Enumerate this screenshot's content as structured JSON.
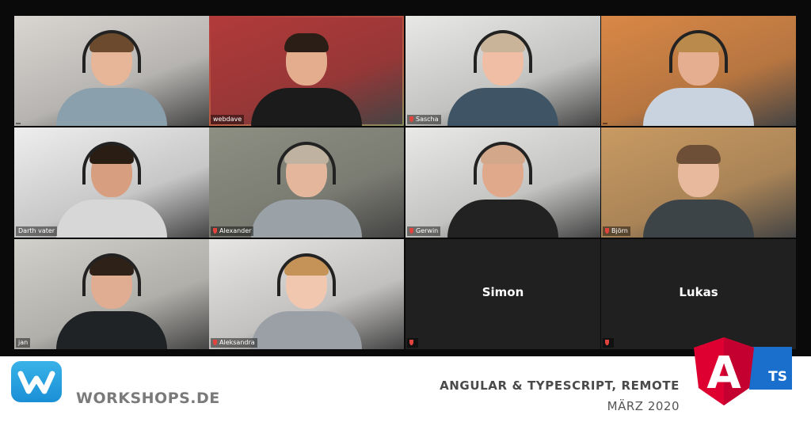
{
  "participants": [
    {
      "name": "",
      "skin": "#e7b597",
      "hair": "#6b4a2e",
      "shirt": "#8aa0ad",
      "bg": "#d9d6d2",
      "headset": true
    },
    {
      "name": "webdave",
      "skin": "#e3ad8e",
      "hair": "#2b1e16",
      "shirt": "#1b1b1b",
      "bg": "#b23a3a",
      "headset": false,
      "active": true
    },
    {
      "name": "Sascha",
      "skin": "#efbea4",
      "hair": "#c9b49a",
      "shirt": "#3f5566",
      "bg": "#e8e8e6",
      "headset": true
    },
    {
      "name": "",
      "skin": "#e6ae90",
      "hair": "#b98a4c",
      "shirt": "#c9d3e0",
      "bg": "#d98846",
      "headset": true
    },
    {
      "name": "Darth vater",
      "skin": "#d79f7f",
      "hair": "#2a1d14",
      "shirt": "#d7d7d7",
      "bg": "#eeeeee",
      "headset": true
    },
    {
      "name": "Alexander",
      "skin": "#e4b79d",
      "hair": "#bfb2a0",
      "shirt": "#9aa2a8",
      "bg": "#8e8f83",
      "headset": true
    },
    {
      "name": "Gerwin",
      "skin": "#e0a98b",
      "hair": "#d3a789",
      "shirt": "#222222",
      "bg": "#e9e9e7",
      "headset": true
    },
    {
      "name": "Björn",
      "skin": "#e9b99e",
      "hair": "#6c4f36",
      "shirt": "#3d4448",
      "bg": "#c99a62",
      "headset": false
    },
    {
      "name": "jan",
      "skin": "#e0ad92",
      "hair": "#2e2118",
      "shirt": "#1f2326",
      "bg": "#d2d0ca",
      "headset": true
    },
    {
      "name": "Aleksandra",
      "skin": "#f1c7b0",
      "hair": "#c59258",
      "shirt": "#9aa0a6",
      "bg": "#e8e6e4",
      "headset": true
    },
    {
      "name": "Simon",
      "blank": true
    },
    {
      "name": "Lukas",
      "blank": true
    }
  ],
  "footer": {
    "brand": "WORKSHOPS.DE",
    "title": "ANGULAR & TYPESCRIPT, REMOTE",
    "date": "MÄRZ 2020",
    "angular_letter": "A",
    "ts_label": "TS"
  },
  "colors": {
    "angular_red": "#dd0031",
    "ts_blue": "#1a6fcd",
    "workshops_blue": "#29a3e3",
    "active_border": "#d8e36a",
    "mic_muted": "#e0443c"
  },
  "icons": [
    "mic-muted-icon",
    "workshops-logo-icon",
    "angular-logo-icon",
    "typescript-logo-icon"
  ]
}
